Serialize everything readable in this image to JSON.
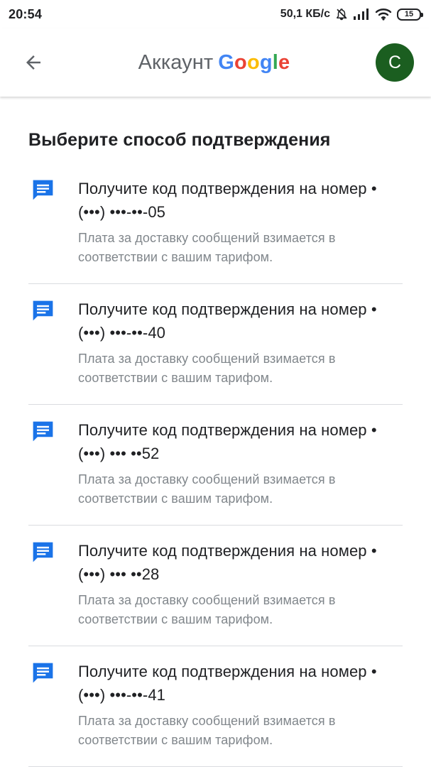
{
  "status_bar": {
    "time": "20:54",
    "network_speed": "50,1 КБ/с",
    "icons": [
      "notifications-off-icon",
      "signal-icon",
      "wifi-icon",
      "battery-icon"
    ],
    "battery_level": "15"
  },
  "header": {
    "back_icon": "arrow-back-icon",
    "title_prefix": "Аккаунт",
    "brand_letters": [
      "G",
      "o",
      "o",
      "g",
      "l",
      "e"
    ],
    "brand_colors": [
      "#4285f4",
      "#ea4335",
      "#fbbc05",
      "#4285f4",
      "#34a853",
      "#ea4335"
    ],
    "avatar_initial": "C",
    "avatar_color": "#1b5e20"
  },
  "main": {
    "title": "Выберите способ подтверждения",
    "options": [
      {
        "icon": "message-icon",
        "title": "Получите код подтверждения на номер •",
        "phone": "(•••) •••-••-05",
        "note": "Плата за доставку сообщений взимается в соответствии с вашим тарифом."
      },
      {
        "icon": "message-icon",
        "title": "Получите код подтверждения на номер •",
        "phone": "(•••) •••-••-40",
        "note": "Плата за доставку сообщений взимается в соответствии с вашим тарифом."
      },
      {
        "icon": "message-icon",
        "title": "Получите код подтверждения на номер •",
        "phone": "(•••) ••• ••52",
        "note": "Плата за доставку сообщений взимается в соответствии с вашим тарифом."
      },
      {
        "icon": "message-icon",
        "title": "Получите код подтверждения на номер •",
        "phone": "(•••) ••• ••28",
        "note": "Плата за доставку сообщений взимается в соответствии с вашим тарифом."
      },
      {
        "icon": "message-icon",
        "title": "Получите код подтверждения на номер •",
        "phone": "(•••) •••-••-41",
        "note": "Плата за доставку сообщений взимается в соответствии с вашим тарифом."
      }
    ]
  },
  "colors": {
    "accent": "#1a73e8",
    "text_primary": "#202124",
    "text_secondary": "#80868b",
    "divider": "#dadce0"
  }
}
